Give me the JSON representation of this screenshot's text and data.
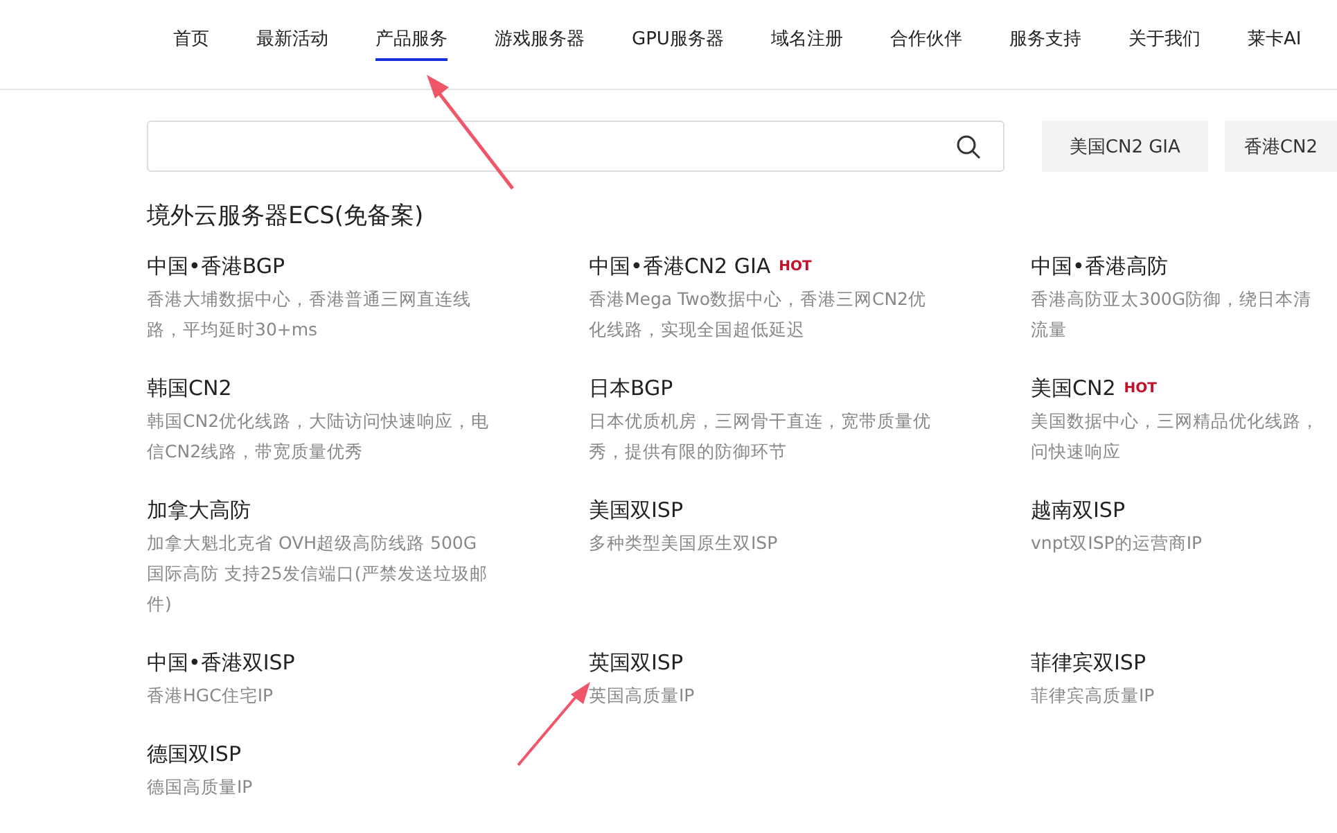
{
  "nav": {
    "tabs": [
      {
        "label": "首页",
        "selected": false
      },
      {
        "label": "最新活动",
        "selected": false
      },
      {
        "label": "产品服务",
        "selected": true
      },
      {
        "label": "游戏服务器",
        "selected": false
      },
      {
        "label": "GPU服务器",
        "selected": false
      },
      {
        "label": "域名注册",
        "selected": false
      },
      {
        "label": "合作伙伴",
        "selected": false
      },
      {
        "label": "服务支持",
        "selected": false
      },
      {
        "label": "关于我们",
        "selected": false
      },
      {
        "label": "莱卡AI",
        "selected": false
      }
    ]
  },
  "search": {
    "quick_tags": [
      "美国CN2 GIA",
      "香港CN2"
    ]
  },
  "section": {
    "title": "境外云服务器ECS(免备案)",
    "products": [
      {
        "name": "中国•香港BGP",
        "description": [
          "香港大埔数据中心，香港普通三网直连线",
          "路，平均延时30+ms"
        ]
      },
      {
        "name": "中国•香港CN2 GIA",
        "badge": "HOT",
        "description": [
          "香港Mega Two数据中心，香港三网CN2优",
          "化线路，实现全国超低延迟"
        ]
      },
      {
        "name": "中国•香港高防",
        "description": [
          "香港高防亚太300G防御，绕日本清",
          "流量"
        ]
      },
      {
        "name": "韩国CN2",
        "description": [
          "韩国CN2优化线路，大陆访问快速响应，电",
          "信CN2线路，带宽质量优秀"
        ]
      },
      {
        "name": "日本BGP",
        "description": [
          "日本优质机房，三网骨干直连，宽带质量优",
          "秀，提供有限的防御环节"
        ]
      },
      {
        "name": "美国CN2",
        "badge": "HOT",
        "description": [
          "美国数据中心，三网精品优化线路，",
          "问快速响应"
        ]
      },
      {
        "name": "加拿大高防",
        "description": [
          "加拿大魁北克省 OVH超级高防线路 500G",
          "国际高防 支持25发信端口(严禁发送垃圾邮",
          "件)"
        ]
      },
      {
        "name": "美国双ISP",
        "description": [
          "多种类型美国原生双ISP"
        ]
      },
      {
        "name": "越南双ISP",
        "description": [
          "vnpt双ISP的运营商IP"
        ]
      },
      {
        "name": "中国•香港双ISP",
        "description": [
          "香港HGC住宅IP"
        ]
      },
      {
        "name": "英国双ISP",
        "description": [
          "英国高质量IP"
        ]
      },
      {
        "name": "菲律宾双ISP",
        "description": [
          "菲律宾高质量IP"
        ]
      },
      {
        "name": "德国双ISP",
        "description": [
          "德国高质量IP"
        ]
      }
    ]
  }
}
